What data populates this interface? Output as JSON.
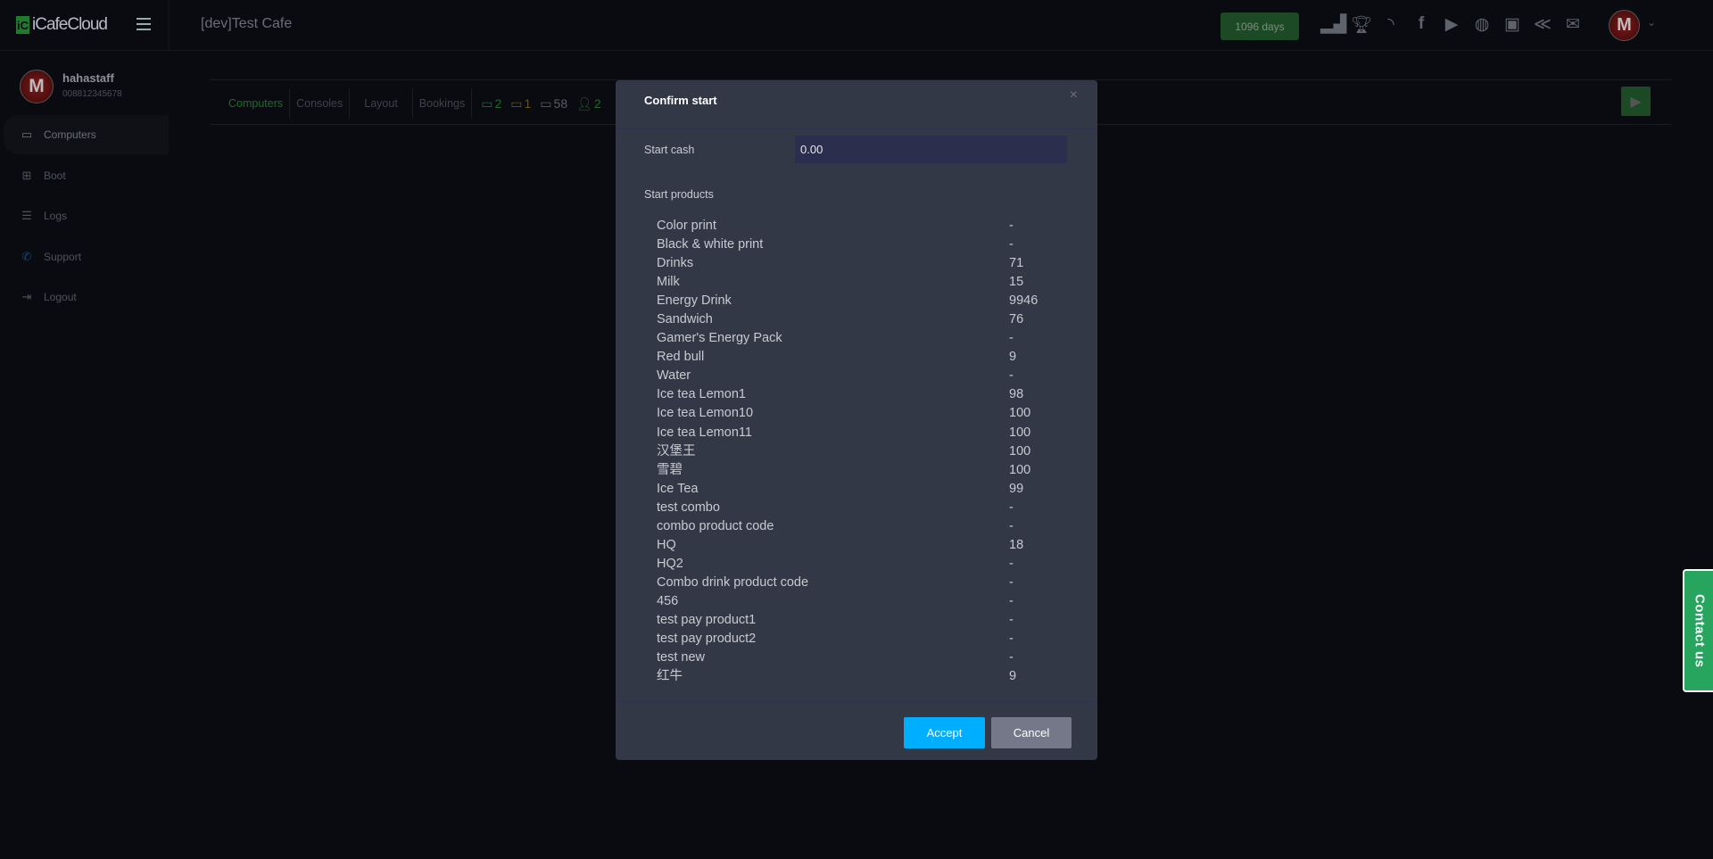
{
  "app": {
    "logo": "iCafeCloud",
    "logo_mark": "iC",
    "cafe_title": "[dev]Test Cafe",
    "days_badge": "1096 days"
  },
  "top_icons": [
    "ranking-icon",
    "trophy-icon",
    "rss-icon",
    "facebook-icon",
    "youtube-icon",
    "globe-icon",
    "icafe-icon",
    "partner-icon",
    "mail-icon"
  ],
  "user": {
    "name": "hahastaff",
    "phone": "008812345678",
    "avatar_letter": "M"
  },
  "sidebar": {
    "items": [
      {
        "label": "Computers",
        "icon": "monitor-icon"
      },
      {
        "label": "Boot",
        "icon": "windows-icon"
      },
      {
        "label": "Logs",
        "icon": "list-icon"
      },
      {
        "label": "Support",
        "icon": "phone-icon"
      },
      {
        "label": "Logout",
        "icon": "logout-icon"
      }
    ]
  },
  "tabs": [
    {
      "label": "Computers"
    },
    {
      "label": "Consoles"
    },
    {
      "label": "Layout"
    },
    {
      "label": "Bookings"
    }
  ],
  "stats": {
    "online": "2",
    "warning": "1",
    "total": "58",
    "members": "2"
  },
  "colors": {
    "accent_green": "#1f7a2e",
    "accept": "#00aeff",
    "cancel": "#747889",
    "contact": "#27a45e",
    "modal_bg": "#333847"
  },
  "modal": {
    "title": "Confirm start",
    "start_cash_label": "Start cash",
    "start_cash_value": "0.00",
    "start_products_label": "Start products",
    "products": [
      {
        "name": "Color print",
        "qty": "-"
      },
      {
        "name": "Black & white print",
        "qty": "-"
      },
      {
        "name": "Drinks",
        "qty": "71"
      },
      {
        "name": "Milk",
        "qty": "15"
      },
      {
        "name": "Energy Drink",
        "qty": "9946"
      },
      {
        "name": "Sandwich",
        "qty": "76"
      },
      {
        "name": "Gamer's Energy Pack",
        "qty": "-"
      },
      {
        "name": "Red bull",
        "qty": "9"
      },
      {
        "name": "Water",
        "qty": "-"
      },
      {
        "name": "Ice tea Lemon1",
        "qty": "98"
      },
      {
        "name": "Ice tea Lemon10",
        "qty": "100"
      },
      {
        "name": "Ice tea Lemon11",
        "qty": "100"
      },
      {
        "name": "汉堡王",
        "qty": "100"
      },
      {
        "name": "雪碧",
        "qty": "100"
      },
      {
        "name": "Ice Tea",
        "qty": "99"
      },
      {
        "name": "test combo",
        "qty": "-"
      },
      {
        "name": "combo product code",
        "qty": "-"
      },
      {
        "name": "HQ",
        "qty": "18"
      },
      {
        "name": "HQ2",
        "qty": "-"
      },
      {
        "name": "Combo drink product code",
        "qty": "-"
      },
      {
        "name": "456",
        "qty": "-"
      },
      {
        "name": "test pay product1",
        "qty": "-"
      },
      {
        "name": "test pay product2",
        "qty": "-"
      },
      {
        "name": "test new",
        "qty": "-"
      },
      {
        "name": "红牛",
        "qty": "9"
      }
    ],
    "accept_label": "Accept",
    "cancel_label": "Cancel"
  },
  "contact_label": "Contact us"
}
